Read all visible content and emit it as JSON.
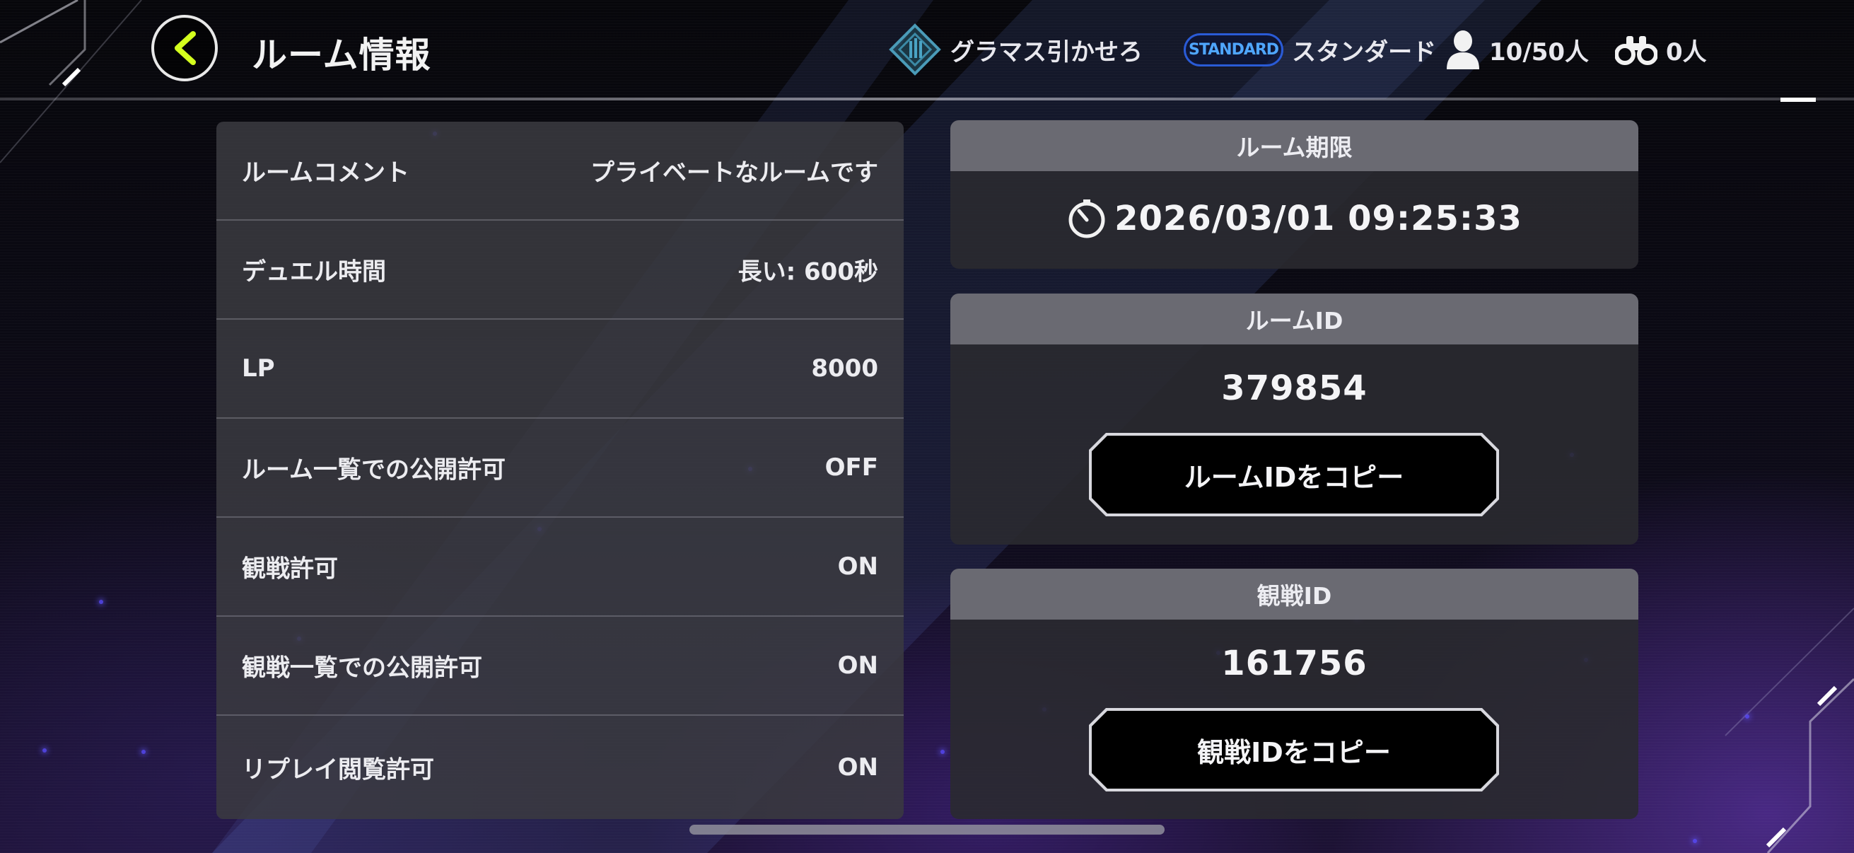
{
  "header": {
    "title": "ルーム情報",
    "mode_label": "グラマス引かせろ",
    "format_badge": "STANDARD",
    "format_label": "スタンダード",
    "players": "10/50人",
    "spectators": "0人"
  },
  "settings": [
    {
      "label": "ルームコメント",
      "value": "プライベートなルームです"
    },
    {
      "label": "デュエル時間",
      "value": "長い: 600秒"
    },
    {
      "label": "LP",
      "value": "8000"
    },
    {
      "label": "ルーム一覧での公開許可",
      "value": "OFF"
    },
    {
      "label": "観戦許可",
      "value": "ON"
    },
    {
      "label": "観戦一覧での公開許可",
      "value": "ON"
    },
    {
      "label": "リプレイ閲覧許可",
      "value": "ON"
    }
  ],
  "expiry": {
    "title": "ルーム期限",
    "value": "2026/03/01 09:25:33"
  },
  "room_id": {
    "title": "ルームID",
    "value": "379854",
    "copy_label": "ルームIDをコピー"
  },
  "spectate_id": {
    "title": "観戦ID",
    "value": "161756",
    "copy_label": "観戦IDをコピー"
  },
  "colors": {
    "accent_back_arrow": "#d4ff1e",
    "standard_badge": "#4fa6ff",
    "panel_bg": "#3a3a40",
    "card_header": "#6e6e76"
  }
}
